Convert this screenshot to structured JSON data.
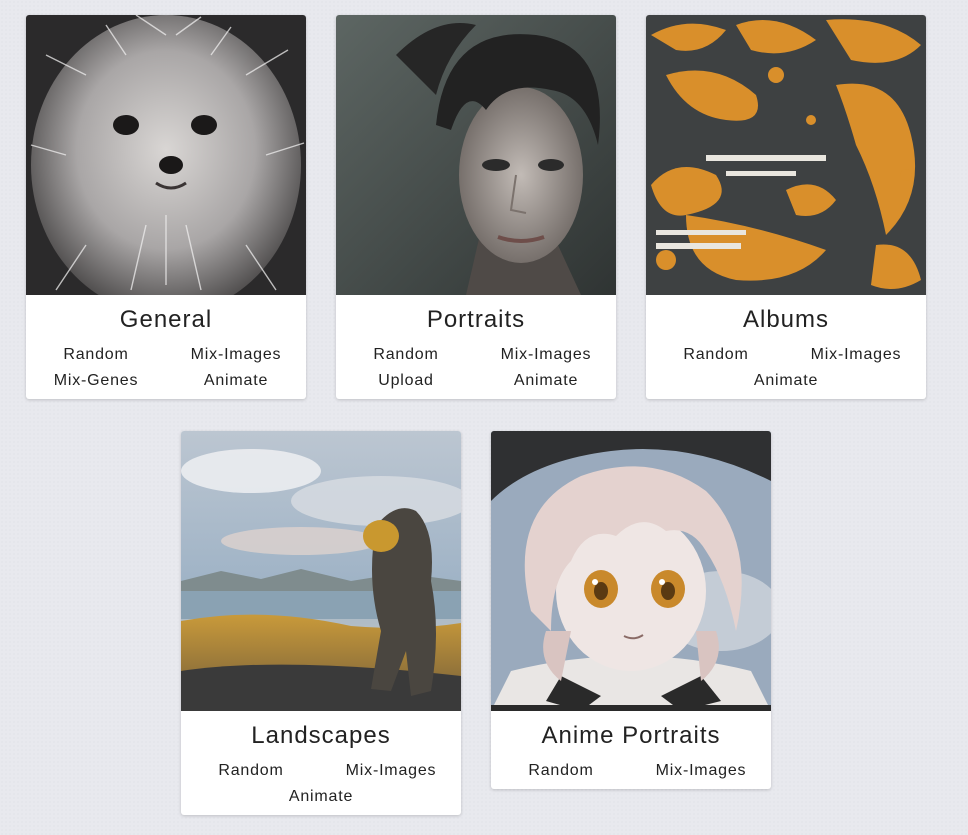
{
  "categories": [
    {
      "title": "General",
      "image_alt": "fluffy white dog",
      "links": [
        "Random",
        "Mix-Images",
        "Mix-Genes",
        "Animate"
      ]
    },
    {
      "title": "Portraits",
      "image_alt": "portrait of a short-haired woman",
      "links": [
        "Random",
        "Mix-Images",
        "Upload",
        "Animate"
      ]
    },
    {
      "title": "Albums",
      "image_alt": "orange and grey album art",
      "links": [
        "Random",
        "Mix-Images",
        "Animate"
      ]
    },
    {
      "title": "Landscapes",
      "image_alt": "rock figure on coast at sunset",
      "links": [
        "Random",
        "Mix-Images",
        "Animate"
      ]
    },
    {
      "title": "Anime Portraits",
      "image_alt": "anime girl with short pink hair",
      "links": [
        "Random",
        "Mix-Images"
      ]
    }
  ]
}
